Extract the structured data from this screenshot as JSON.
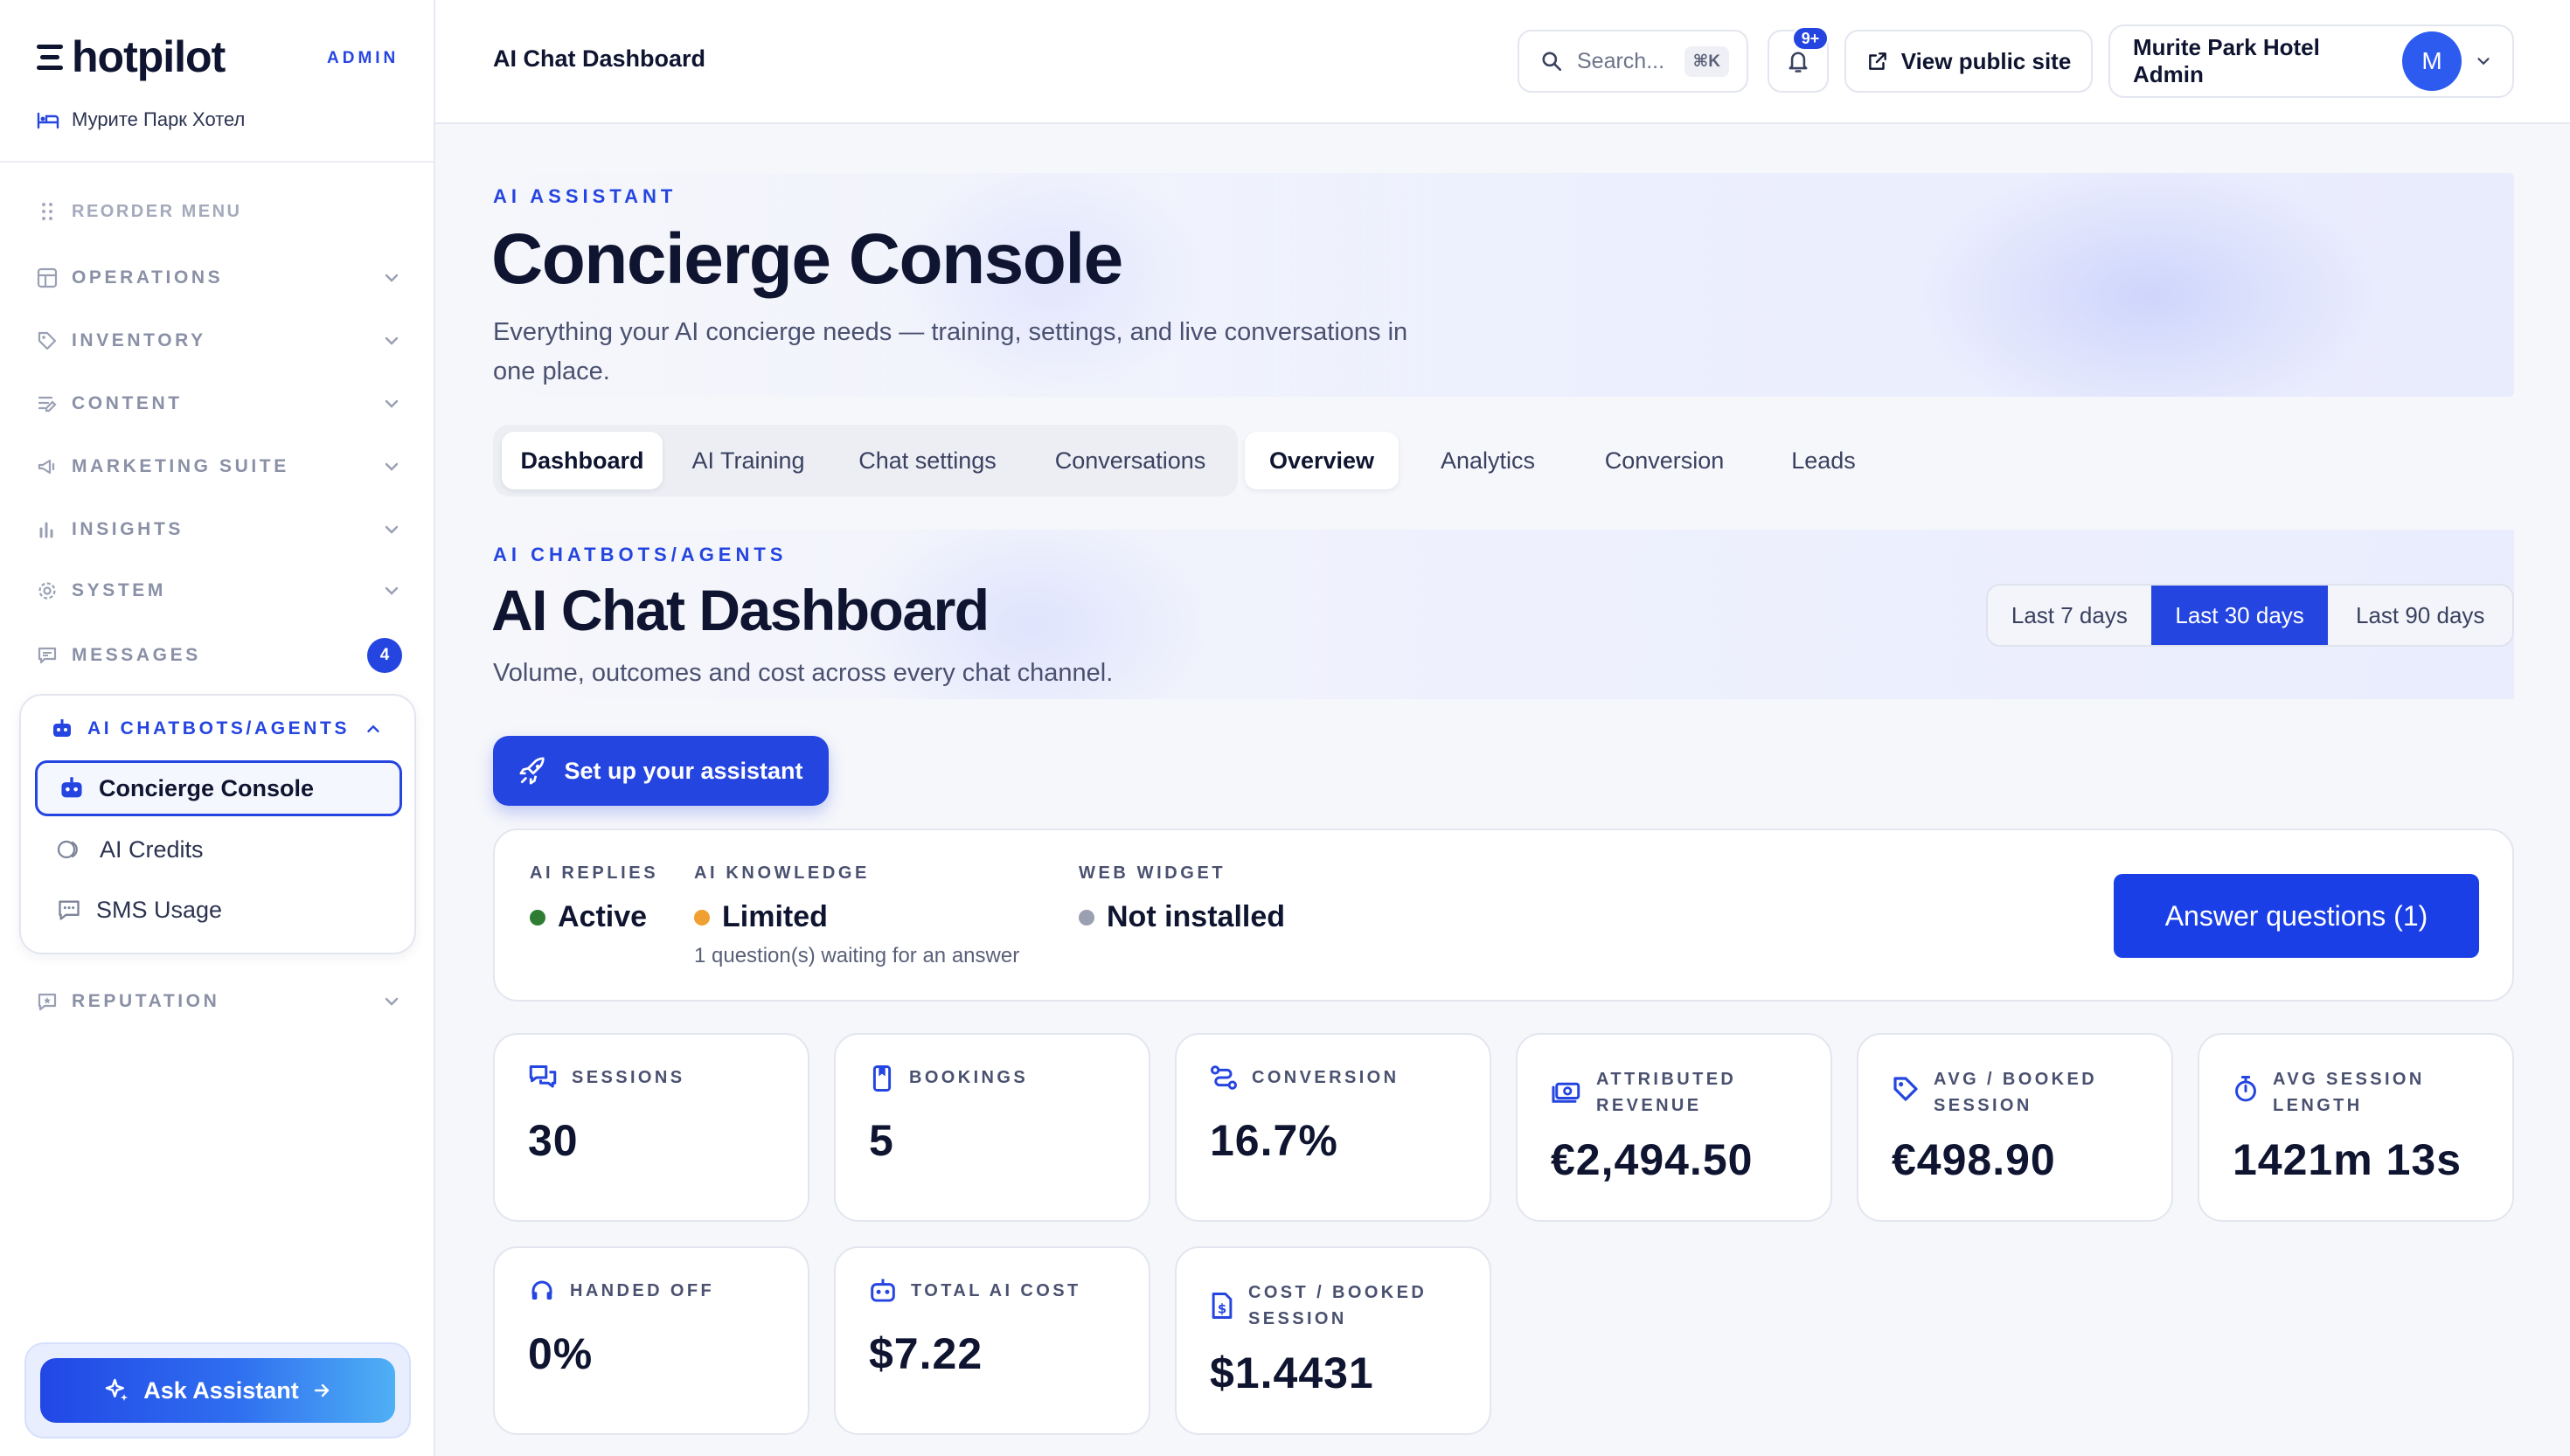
{
  "sidebar": {
    "brand": "hotpilot",
    "admin_tag": "ADMIN",
    "hotel_name": "Мурите Парк Хотел",
    "reorder_label": "REORDER MENU",
    "nav": [
      {
        "label": "OPERATIONS",
        "icon": "grid-icon"
      },
      {
        "label": "INVENTORY",
        "icon": "tag-icon"
      },
      {
        "label": "CONTENT",
        "icon": "edit-lines-icon"
      },
      {
        "label": "MARKETING SUITE",
        "icon": "megaphone-icon"
      },
      {
        "label": "INSIGHTS",
        "icon": "bar-chart-icon"
      },
      {
        "label": "SYSTEM",
        "icon": "gear-icon"
      },
      {
        "label": "MESSAGES",
        "icon": "chat-icon",
        "badge": "4"
      }
    ],
    "ai_section": {
      "label": "AI CHATBOTS/AGENTS",
      "items": [
        {
          "label": "Concierge Console",
          "icon": "robot-icon",
          "active": true
        },
        {
          "label": "AI Credits",
          "icon": "coins-icon"
        },
        {
          "label": "SMS Usage",
          "icon": "message-square-icon"
        }
      ]
    },
    "reputation_label": "REPUTATION",
    "ask_assistant": "Ask Assistant"
  },
  "topbar": {
    "title": "AI Chat Dashboard",
    "search_placeholder": "Search...",
    "search_shortcut": "⌘K",
    "notifications_badge": "9+",
    "view_public_site": "View public site",
    "account_name": "Murite Park Hotel Admin",
    "avatar_initial": "M"
  },
  "hero": {
    "eyebrow": "AI ASSISTANT",
    "title": "Concierge Console",
    "description_line1": "Everything your AI concierge needs — training, settings, and live conversations in",
    "description_line2": "one place."
  },
  "tabs": {
    "primary": [
      "Dashboard",
      "AI Training",
      "Chat settings",
      "Conversations"
    ],
    "primary_active": "Dashboard",
    "secondary": [
      "Overview",
      "Analytics",
      "Conversion",
      "Leads"
    ],
    "secondary_active": "Overview"
  },
  "section": {
    "eyebrow": "AI CHATBOTS/AGENTS",
    "title": "AI Chat Dashboard",
    "description": "Volume, outcomes and cost across every chat channel.",
    "ranges": [
      "Last 7 days",
      "Last 30 days",
      "Last 90 days"
    ],
    "range_active": "Last 30 days",
    "setup_button": "Set up your assistant"
  },
  "status": {
    "replies": {
      "label": "AI REPLIES",
      "value": "Active",
      "color": "#2e7d32"
    },
    "knowledge": {
      "label": "AI KNOWLEDGE",
      "value": "Limited",
      "color": "#f0a030",
      "note": "1 question(s) waiting for an answer"
    },
    "widget": {
      "label": "WEB WIDGET",
      "value": "Not installed",
      "color": "#9aa0b2"
    },
    "answer_button": "Answer questions (1)"
  },
  "metrics": [
    {
      "label": "SESSIONS",
      "value": "30",
      "icon": "chat-bubbles-icon"
    },
    {
      "label": "BOOKINGS",
      "value": "5",
      "icon": "bookmark-icon"
    },
    {
      "label": "CONVERSION",
      "value": "16.7%",
      "icon": "route-icon"
    },
    {
      "label": "ATTRIBUTED REVENUE",
      "value": "€2,494.50",
      "icon": "cash-icon"
    },
    {
      "label": "AVG / BOOKED SESSION",
      "value": "€498.90",
      "icon": "price-tag-icon"
    },
    {
      "label": "AVG SESSION LENGTH",
      "value": "1421m 13s",
      "icon": "stopwatch-icon"
    },
    {
      "label": "HANDED OFF",
      "value": "0%",
      "icon": "headset-icon"
    },
    {
      "label": "TOTAL AI COST",
      "value": "$7.22",
      "icon": "robot-icon"
    },
    {
      "label": "COST / BOOKED SESSION",
      "value": "$1.4431",
      "icon": "invoice-icon"
    }
  ],
  "colors": {
    "accent": "#2545e0",
    "text": "#0f1530",
    "muted": "#8a90a6"
  }
}
